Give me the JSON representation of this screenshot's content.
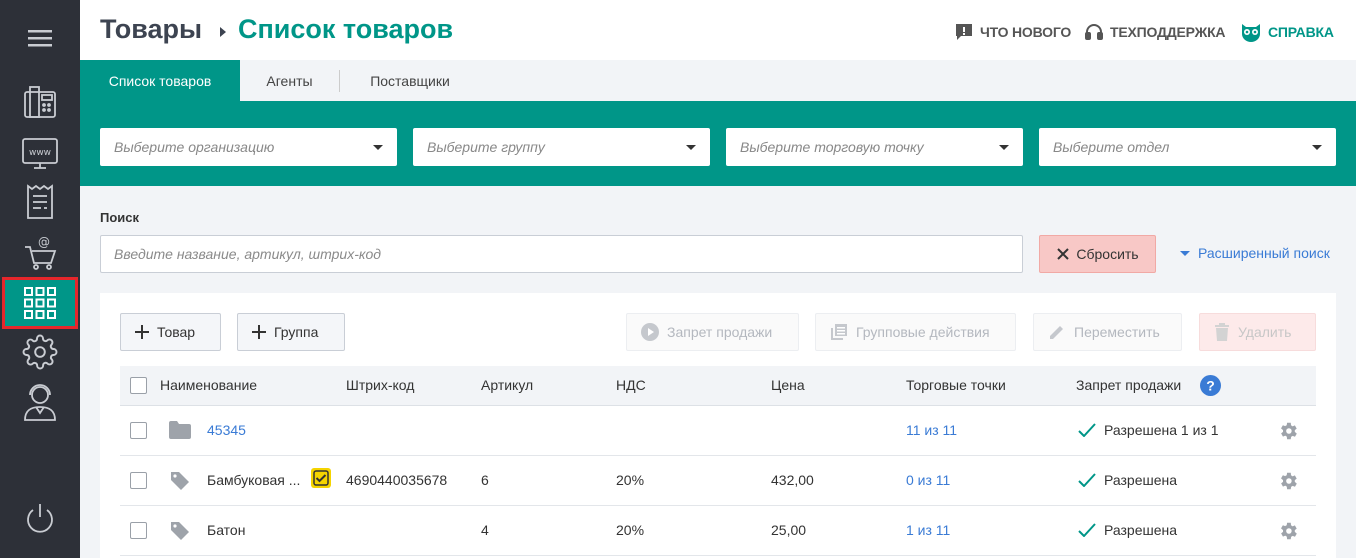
{
  "sidebar": {
    "items": [
      {
        "icon": "menu-icon"
      },
      {
        "icon": "calculator-icon"
      },
      {
        "icon": "www-icon"
      },
      {
        "icon": "receipt-icon"
      },
      {
        "icon": "cart-icon"
      },
      {
        "icon": "grid-icon",
        "active": true
      },
      {
        "icon": "gear-icon"
      },
      {
        "icon": "support-agent-icon"
      },
      {
        "icon": "power-icon"
      }
    ]
  },
  "header": {
    "breadcrumb_root": "Товары",
    "title": "Список товаров",
    "whats_new": "ЧТО НОВОГО",
    "support": "ТЕХПОДДЕРЖКА",
    "help": "СПРАВКА"
  },
  "tabs": [
    "Список товаров",
    "Агенты",
    "Поставщики"
  ],
  "filters": {
    "organization": "Выберите организацию",
    "group": "Выберите группу",
    "shop": "Выберите торговую точку",
    "department": "Выберите отдел"
  },
  "search": {
    "label": "Поиск",
    "placeholder": "Введите название, артикул, штрих-код",
    "reset": "Сбросить",
    "advanced": "Расширенный поиск"
  },
  "toolbar": {
    "add_product": "Товар",
    "add_group": "Группа",
    "ban_sale": "Запрет продажи",
    "group_actions": "Групповые действия",
    "move": "Переместить",
    "delete": "Удалить"
  },
  "table": {
    "columns": [
      "Наименование",
      "Штрих-код",
      "Артикул",
      "НДС",
      "Цена",
      "Торговые точки",
      "Запрет продажи"
    ],
    "rows": [
      {
        "type": "folder",
        "name": "45345",
        "barcode": "",
        "article": "",
        "vat": "",
        "price": "",
        "shops": "11 из 11",
        "sale": "Разрешена 1 из 1"
      },
      {
        "type": "product",
        "name": "Бамбуковая ...",
        "barcode": "4690440035678",
        "article": "6",
        "vat": "20%",
        "price": "432,00",
        "shops": "0 из 11",
        "sale": "Разрешена"
      },
      {
        "type": "product",
        "name": "Батон",
        "barcode": "",
        "article": "4",
        "vat": "20%",
        "price": "25,00",
        "shops": "1 из 11",
        "sale": "Разрешена"
      }
    ]
  },
  "colors": {
    "accent": "#009688",
    "sidebar": "#2d3038",
    "link": "#3a7bd5",
    "active_outline": "#e5262b"
  }
}
